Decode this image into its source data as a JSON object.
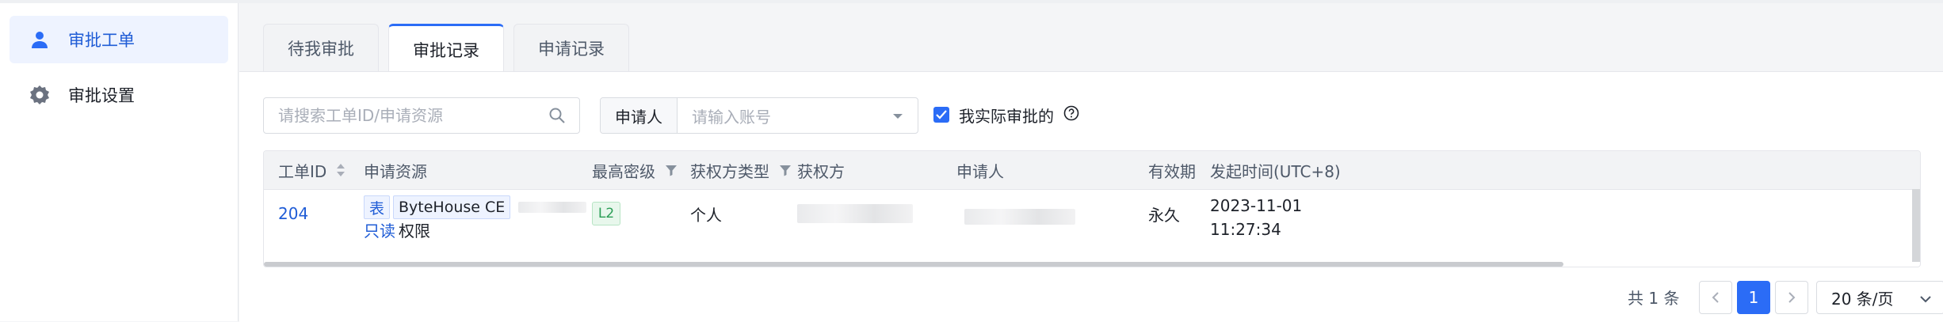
{
  "sidebar": {
    "items": [
      {
        "label": "审批工单",
        "icon": "user-icon",
        "active": true
      },
      {
        "label": "审批设置",
        "icon": "gear-icon",
        "active": false
      }
    ]
  },
  "tabs": [
    {
      "label": "待我审批"
    },
    {
      "label": "审批记录",
      "active": true
    },
    {
      "label": "申请记录"
    }
  ],
  "filters": {
    "search_placeholder": "请搜索工单ID/申请资源",
    "applicant_label": "申请人",
    "applicant_placeholder": "请输入账号",
    "checkbox_label": "我实际审批的",
    "checkbox_checked": true
  },
  "table": {
    "headers": {
      "id": "工单ID",
      "resource": "申请资源",
      "level": "最高密级",
      "grantee_type": "获权方类型",
      "grantee": "获权方",
      "applicant": "申请人",
      "validity": "有效期",
      "time": "发起时间(UTC+8)"
    },
    "rows": [
      {
        "id": "204",
        "resource_tag": "表",
        "resource_name": "ByteHouse CE",
        "permission_link": "只读",
        "permission_suffix": "权限",
        "level": "L2",
        "grantee_type": "个人",
        "validity": "永久",
        "time_date": "2023-11-01",
        "time_clock": "11:27:34"
      }
    ]
  },
  "pagination": {
    "total_text": "共 1 条",
    "current_page": "1",
    "page_size": "20 条/页"
  },
  "colors": {
    "accent": "#2b6cf6",
    "link": "#1f5cd6",
    "level_green": "#2a9d55"
  }
}
